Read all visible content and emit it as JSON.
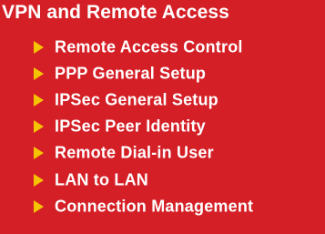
{
  "menu": {
    "title": "VPN and Remote Access",
    "background_color": "#d51f26",
    "text_color": "#ffffff",
    "arrow_color": "#f5c400",
    "items": [
      {
        "label": "Remote Access Control",
        "icon": "triangle-right-icon"
      },
      {
        "label": "PPP General Setup",
        "icon": "triangle-right-icon"
      },
      {
        "label": "IPSec General Setup",
        "icon": "triangle-right-icon"
      },
      {
        "label": "IPSec Peer Identity",
        "icon": "triangle-right-icon"
      },
      {
        "label": "Remote Dial-in User",
        "icon": "triangle-right-icon"
      },
      {
        "label": "LAN to LAN",
        "icon": "triangle-right-icon"
      },
      {
        "label": "Connection Management",
        "icon": "triangle-right-icon"
      }
    ]
  }
}
